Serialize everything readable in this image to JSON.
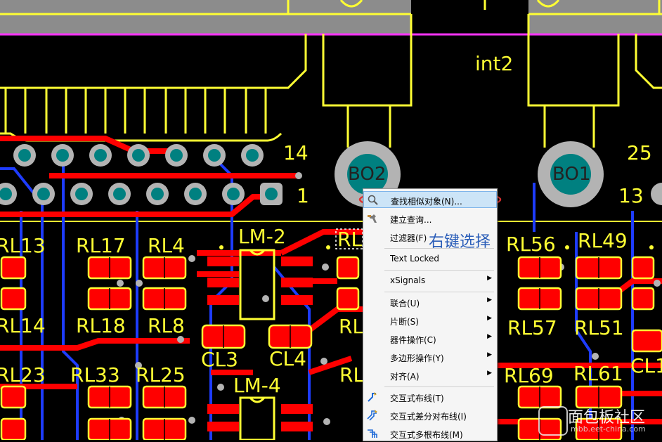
{
  "colors": {
    "background": "#000000",
    "silkscreen": "#ffff33",
    "top_copper": "#ff0000",
    "bottom_copper": "#1e3cff",
    "via_ring": "#b3b3b3",
    "pad_hole": "#008080",
    "menu_background": "#f5f5f5",
    "menu_highlight": "#cce4f7",
    "annotation_blue": "#2a5db8",
    "ellipse_red": "#e03030"
  },
  "board": {
    "labels": {
      "int2": "int2",
      "pin14": "14",
      "pin1": "1",
      "pin25": "25",
      "pin13": "13",
      "lm2": "LM-2",
      "lm4": "LM-4",
      "rl13": "RL13",
      "rl17": "RL17",
      "rl4": "RL4",
      "rl14": "RL14",
      "rl18": "RL18",
      "rl8": "RL8",
      "cl3": "CL3",
      "cl4": "CL4",
      "rl23": "RL23",
      "rl33": "RL33",
      "rl25": "RL25",
      "rl56": "RL56",
      "rl49": "RL49",
      "rl57": "RL57",
      "rl51": "RL51",
      "rl69": "RL69",
      "rl61": "RL61",
      "cl1": "CL1",
      "rl_partial_a": "RL",
      "rl_partial_b": "RL",
      "rl_partial_c": "RL"
    },
    "pads": {
      "bo2": "BO2",
      "bo1": "BO1"
    }
  },
  "context_menu": {
    "items": [
      {
        "label": "查找相似对象(N)...",
        "icon": "find-similar-icon",
        "submenu": false,
        "highlighted": true
      },
      {
        "label": "建立查询...",
        "icon": "build-query-icon",
        "submenu": false
      },
      {
        "label": "过滤器(F)",
        "icon": "",
        "submenu": false
      },
      {
        "label": "Text Locked",
        "icon": "",
        "submenu": false
      },
      {
        "label": "xSignals",
        "icon": "",
        "submenu": true
      },
      {
        "label": "联合(U)",
        "icon": "",
        "submenu": true
      },
      {
        "label": "片断(S)",
        "icon": "",
        "submenu": true
      },
      {
        "label": "器件操作(C)",
        "icon": "",
        "submenu": true
      },
      {
        "label": "多边形操作(Y)",
        "icon": "",
        "submenu": true
      },
      {
        "label": "对齐(A)",
        "icon": "",
        "submenu": true
      },
      {
        "label": "交互式布线(T)",
        "icon": "interactive-routing-icon",
        "submenu": false
      },
      {
        "label": "交互式差分对布线(I)",
        "icon": "diff-pair-routing-icon",
        "submenu": false
      },
      {
        "label": "交互式多根布线(M)",
        "icon": "multi-routing-icon",
        "submenu": false
      }
    ]
  },
  "annotation": {
    "text": "右键选择"
  },
  "watermark": {
    "title": "面包板社区",
    "url": "mbb.eet-china.com"
  }
}
